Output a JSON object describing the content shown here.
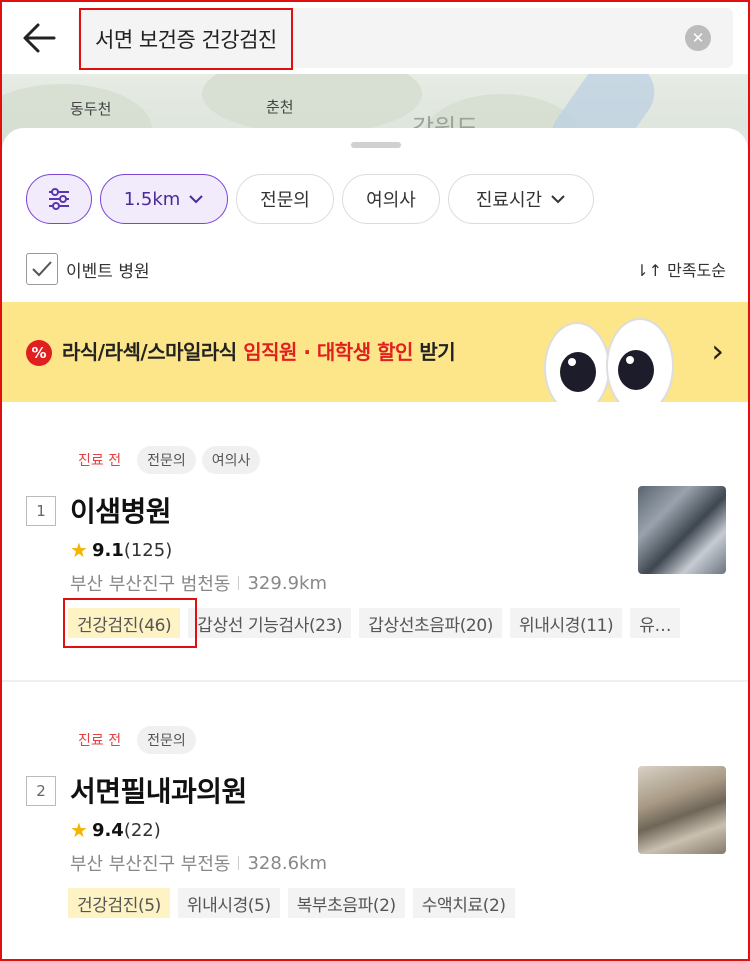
{
  "search": {
    "query": "서면 보건증 건강검진",
    "clear_glyph": "✕",
    "back_icon": "arrow-left-icon"
  },
  "map": {
    "labels": [
      "동두천",
      "춘천",
      "강원도"
    ]
  },
  "filters": {
    "settings_icon": "sliders-icon",
    "distance": "1.5km",
    "specialist": "전문의",
    "female_doctor": "여의사",
    "hours": "진료시간"
  },
  "event_filter": {
    "label": "이벤트 병원",
    "checked": true
  },
  "sort": {
    "label": "⇂↑ 만족도순"
  },
  "banner": {
    "badge": "%",
    "text_before": "라식/라섹/스마일라식 ",
    "text_highlight": "임직원 · 대학생 할인",
    "text_after": " 받기",
    "arrow": "›",
    "accent_color": "#e02020",
    "background": "#fde58a"
  },
  "results": [
    {
      "rank": "1",
      "badges": [
        "진료 전",
        "전문의",
        "여의사"
      ],
      "name": "이샘병원",
      "score": "9.1",
      "reviews": "(125)",
      "address": "부산 부산진구 범천동",
      "distance": "329.9km",
      "tags": [
        "건강검진(46)",
        "갑상선 기능검사(23)",
        "갑상선초음파(20)",
        "위내시경(11)",
        "유…"
      ]
    },
    {
      "rank": "2",
      "badges": [
        "진료 전",
        "전문의"
      ],
      "name": "서면필내과의원",
      "score": "9.4",
      "reviews": "(22)",
      "address": "부산 부산진구 부전동",
      "distance": "328.6km",
      "tags": [
        "건강검진(5)",
        "위내시경(5)",
        "복부초음파(2)",
        "수액치료(2)"
      ]
    }
  ]
}
